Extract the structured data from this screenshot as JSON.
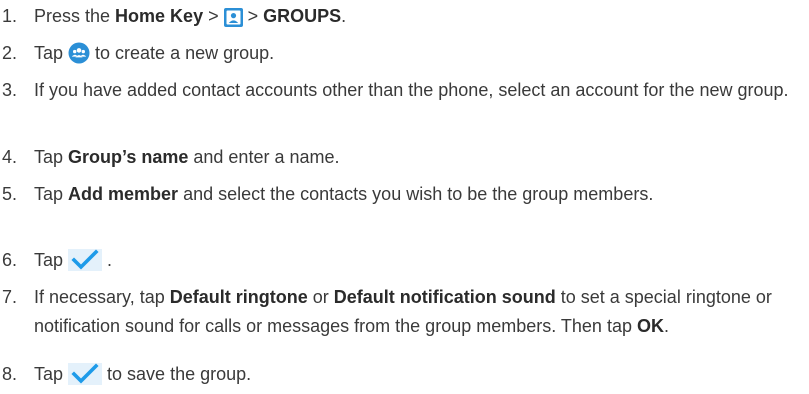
{
  "steps": [
    {
      "number": "1.",
      "parts": {
        "a": "Press the ",
        "b": "Home Key",
        "c": " > ",
        "d": " > ",
        "e": "GROUPS",
        "f": "."
      }
    },
    {
      "number": "2.",
      "parts": {
        "a": "Tap ",
        "b": " to create a new group."
      }
    },
    {
      "number": "3.",
      "text": "If you have added contact accounts other than the phone, select an account for the new group."
    },
    {
      "number": "4.",
      "parts": {
        "a": "Tap ",
        "b": "Group’s name",
        "c": " and enter a name."
      }
    },
    {
      "number": "5.",
      "parts": {
        "a": "Tap ",
        "b": "Add member",
        "c": " and select the contacts you wish to be the group members."
      }
    },
    {
      "number": "6.",
      "parts": {
        "a": "Tap ",
        "b": " ."
      }
    },
    {
      "number": "7.",
      "parts": {
        "a": "If necessary, tap ",
        "b": "Default ringtone",
        "c": " or ",
        "d": "Default notification sound",
        "e": " to set a special ringtone or notification sound for calls or messages from the group members. Then tap ",
        "f": "OK",
        "g": "."
      }
    },
    {
      "number": "8.",
      "parts": {
        "a": "Tap ",
        "b": " to save the group."
      }
    }
  ],
  "icons": {
    "contacts": "contacts-app-icon",
    "new_group": "new-group-icon",
    "checkmark": "checkmark-icon"
  },
  "colors": {
    "text": "#3a3a3a",
    "icon_blue": "#2b8fd6",
    "check_blue": "#1e9be9"
  }
}
